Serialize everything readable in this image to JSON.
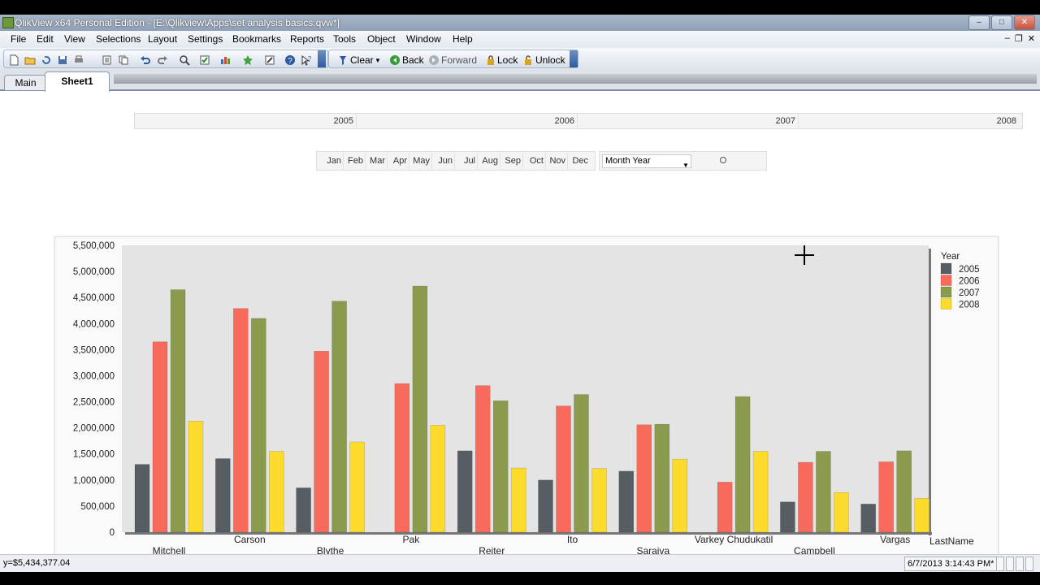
{
  "window": {
    "title": "QlikView x64 Personal Edition - [E:\\Qlikview\\Apps\\set analysis basics.qvw*]"
  },
  "menu": [
    "File",
    "Edit",
    "View",
    "Selections",
    "Layout",
    "Settings",
    "Bookmarks",
    "Reports",
    "Tools",
    "Object",
    "Window",
    "Help"
  ],
  "toolbar": {
    "clear_label": "Clear",
    "back_label": "Back",
    "forward_label": "Forward",
    "lock_label": "Lock",
    "unlock_label": "Unlock"
  },
  "tabs": [
    {
      "label": "Main"
    },
    {
      "label": "Sheet1"
    }
  ],
  "year_listbox": [
    "2005",
    "2006",
    "2007",
    "2008"
  ],
  "month_listbox": [
    "Jan",
    "Feb",
    "Mar",
    "Apr",
    "May",
    "Jun",
    "Jul",
    "Aug",
    "Sep",
    "Oct",
    "Nov",
    "Dec"
  ],
  "month_year_field": {
    "label": "Month Year"
  },
  "status": {
    "left": "y=$5,434,377.04",
    "right": "6/7/2013 3:14:43 PM*"
  },
  "colors": {
    "2005": "#565d63",
    "2006": "#f86b5c",
    "2007": "#8a9b4e",
    "2008": "#fddb2c",
    "plot_bg": "#e4e4e4"
  },
  "chart_data": {
    "type": "bar",
    "xlabel": "LastName",
    "ylabel": "",
    "legend_title": "Year",
    "legend_position": "right",
    "ylim": [
      0,
      5500000
    ],
    "yticks": [
      "0",
      "500,000",
      "1,000,000",
      "1,500,000",
      "2,000,000",
      "2,500,000",
      "3,000,000",
      "3,500,000",
      "4,000,000",
      "4,500,000",
      "5,000,000",
      "5,500,000"
    ],
    "categories": [
      "Mitchell",
      "Carson",
      "Blythe",
      "Pak",
      "Reiter",
      "Ito",
      "Saraiva",
      "Varkey Chudukatil",
      "Campbell",
      "Vargas"
    ],
    "series": [
      {
        "name": "2005",
        "values": [
          1300000,
          1410000,
          850000,
          0,
          1560000,
          1000000,
          1170000,
          0,
          580000,
          540000
        ]
      },
      {
        "name": "2006",
        "values": [
          3650000,
          4290000,
          3470000,
          2850000,
          2810000,
          2420000,
          2060000,
          960000,
          1340000,
          1350000
        ]
      },
      {
        "name": "2007",
        "values": [
          4650000,
          4100000,
          4430000,
          4720000,
          2520000,
          2640000,
          2070000,
          2600000,
          1550000,
          1560000
        ]
      },
      {
        "name": "2008",
        "values": [
          2130000,
          1550000,
          1730000,
          2050000,
          1230000,
          1220000,
          1400000,
          1550000,
          760000,
          650000
        ]
      }
    ]
  }
}
